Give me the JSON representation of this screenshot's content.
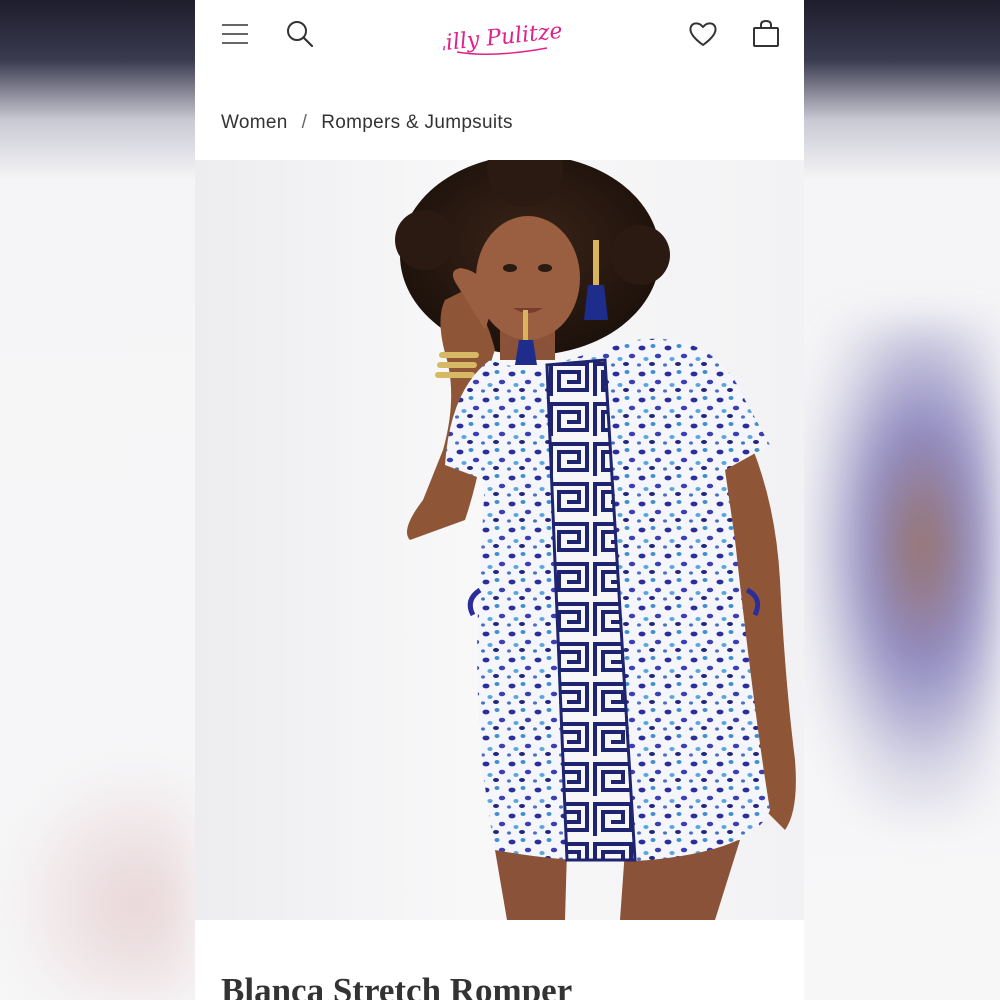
{
  "header": {
    "brand": "Lilly Pulitzer",
    "brand_color": "#e0218a",
    "icons": [
      "menu-icon",
      "search-icon",
      "heart-icon",
      "shopping-bag-icon"
    ]
  },
  "breadcrumb": {
    "items": [
      "Women",
      "Rompers & Jumpsuits"
    ],
    "separator": "/"
  },
  "product": {
    "title": "Blanca Stretch Romper",
    "image": "model-in-blue-print-romper"
  }
}
